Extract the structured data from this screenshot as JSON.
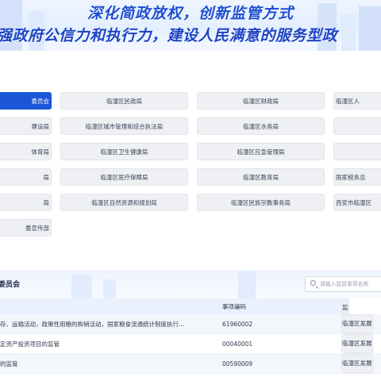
{
  "banner": {
    "title": "深化简政放权，创新监管方式",
    "subtitle": "强政府公信力和执行力，建设人民满意的服务型政"
  },
  "departments": [
    [
      "委员会",
      "临潼区民政局",
      "临潼区财政局",
      "临潼区人"
    ],
    [
      "建设局",
      "临潼区城市管理和综合执法局",
      "临潼区水务局",
      ""
    ],
    [
      "体育局",
      "临潼区卫生健康局",
      "临潼区应急管理局",
      ""
    ],
    [
      "局",
      "临潼区医疗保障局",
      "临潼区教育局",
      "国家税务总"
    ],
    [
      "局",
      "临潼区自然资源和规划局",
      "临潼区民族宗教事务局",
      "西安市临潼区"
    ],
    [
      "委宣传部",
      "",
      "",
      ""
    ]
  ],
  "panel": {
    "title": "委员会",
    "search_placeholder": "请输入监管事项名称"
  },
  "table": {
    "headers": {
      "name": "",
      "code": "事项编码",
      "dept": "监"
    },
    "rows": [
      {
        "name": "存、运输活动，政策性用粮的购销活动，国家粮食流通统计制度执行...",
        "code": "61960002",
        "dept": "临潼区发展"
      },
      {
        "name": "定资产投资项目的监管",
        "code": "00040001",
        "dept": "临潼区发展"
      },
      {
        "name": "的监管",
        "code": "00590009",
        "dept": "临潼区发展"
      }
    ]
  }
}
